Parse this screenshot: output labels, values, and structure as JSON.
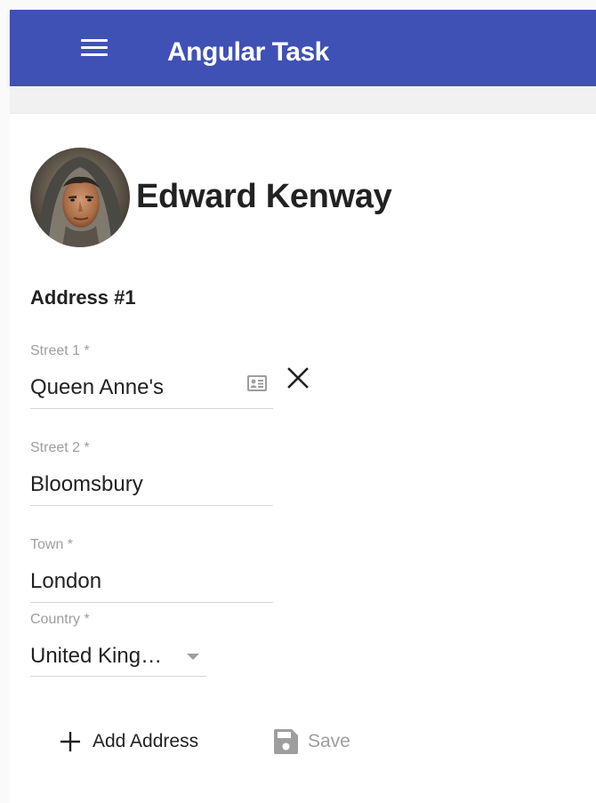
{
  "app": {
    "title": "Angular Task",
    "menu_icon": "menu-icon",
    "primary_color": "#3f51b5"
  },
  "user": {
    "name": "Edward Kenway",
    "avatar": "user-avatar"
  },
  "address": {
    "heading": "Address #1",
    "street1": {
      "label": "Street 1 *",
      "value": "Queen Anne's"
    },
    "street2": {
      "label": "Street 2 *",
      "value": "Bloomsbury"
    },
    "town": {
      "label": "Town *",
      "value": "London"
    },
    "country": {
      "label": "Country *",
      "value": "United King…"
    }
  },
  "actions": {
    "add_label": "Add Address",
    "save_label": "Save",
    "save_disabled": true
  }
}
